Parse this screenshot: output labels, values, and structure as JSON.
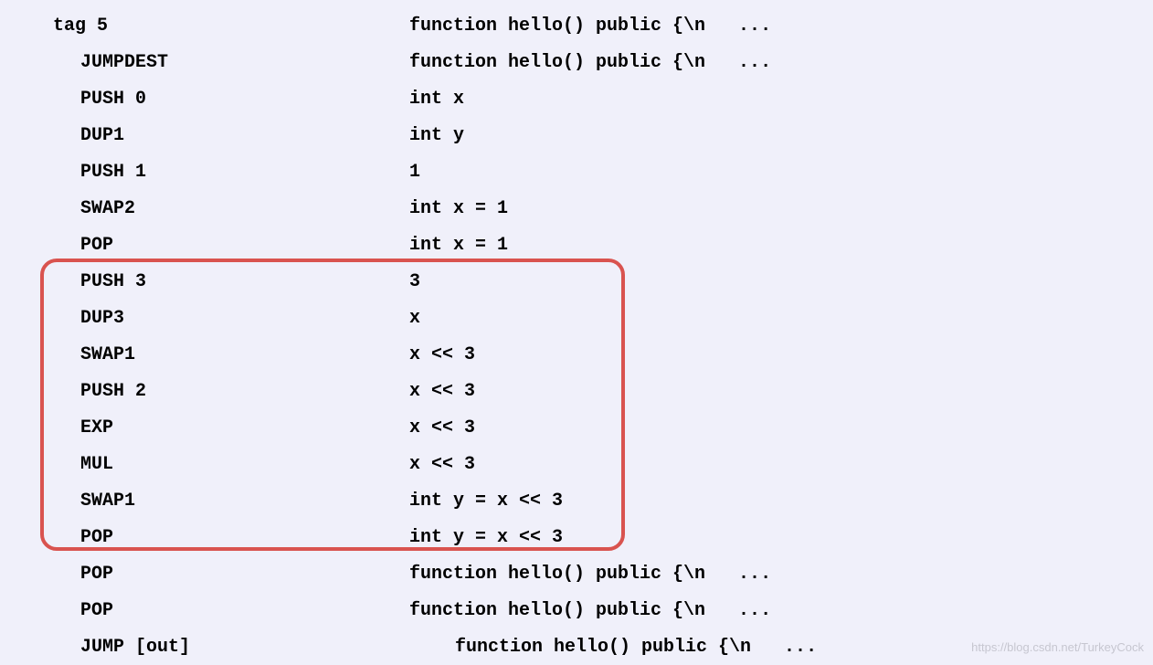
{
  "rows": [
    {
      "left": "tag 5",
      "leftIndent": false,
      "right": "function hello() public {\\n   ...",
      "rightIndent": false
    },
    {
      "left": "JUMPDEST",
      "leftIndent": true,
      "right": "function hello() public {\\n   ...",
      "rightIndent": false
    },
    {
      "left": "PUSH 0",
      "leftIndent": true,
      "right": "int x",
      "rightIndent": false
    },
    {
      "left": "DUP1",
      "leftIndent": true,
      "right": "int y",
      "rightIndent": false
    },
    {
      "left": "PUSH 1",
      "leftIndent": true,
      "right": "1",
      "rightIndent": false
    },
    {
      "left": "SWAP2",
      "leftIndent": true,
      "right": "int x = 1",
      "rightIndent": false
    },
    {
      "left": "POP",
      "leftIndent": true,
      "right": "int x = 1",
      "rightIndent": false
    },
    {
      "left": "PUSH 3",
      "leftIndent": true,
      "right": "3",
      "rightIndent": false
    },
    {
      "left": "DUP3",
      "leftIndent": true,
      "right": "x",
      "rightIndent": false
    },
    {
      "left": "SWAP1",
      "leftIndent": true,
      "right": "x << 3",
      "rightIndent": false
    },
    {
      "left": "PUSH 2",
      "leftIndent": true,
      "right": "x << 3",
      "rightIndent": false
    },
    {
      "left": "EXP",
      "leftIndent": true,
      "right": "x << 3",
      "rightIndent": false
    },
    {
      "left": "MUL",
      "leftIndent": true,
      "right": "x << 3",
      "rightIndent": false
    },
    {
      "left": "SWAP1",
      "leftIndent": true,
      "right": "int y = x << 3",
      "rightIndent": false
    },
    {
      "left": "POP",
      "leftIndent": true,
      "right": "int y = x << 3",
      "rightIndent": false
    },
    {
      "left": "POP",
      "leftIndent": true,
      "right": "function hello() public {\\n   ...",
      "rightIndent": false
    },
    {
      "left": "POP",
      "leftIndent": true,
      "right": "function hello() public {\\n   ...",
      "rightIndent": false
    },
    {
      "left": "JUMP [out]",
      "leftIndent": true,
      "right": "function hello() public {\\n   ...",
      "rightIndent": true
    }
  ],
  "highlight": {
    "startRow": 7,
    "endRow": 14
  },
  "watermark": "https://blog.csdn.net/TurkeyCock"
}
